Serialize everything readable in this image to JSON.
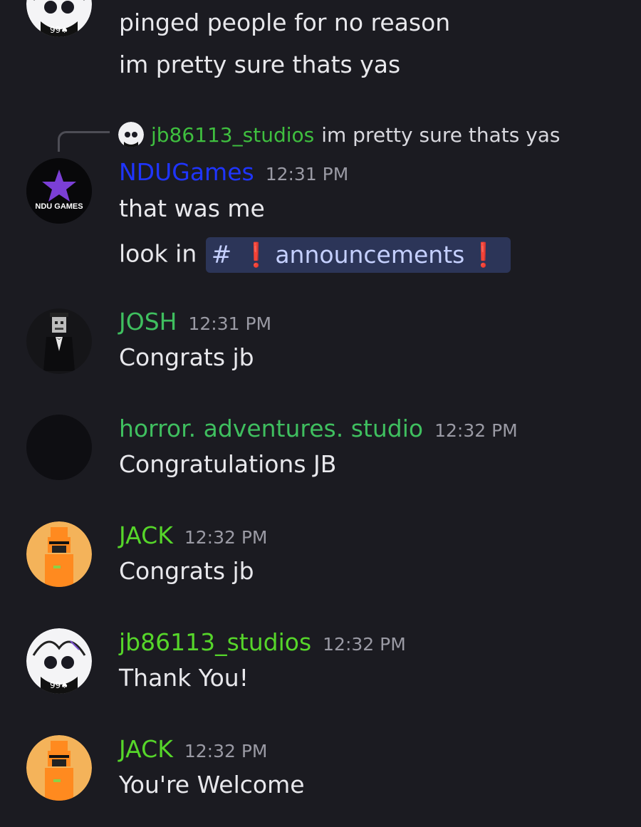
{
  "colors": {
    "background": "#1b1b21",
    "text": "#e8e8ec",
    "timestamp": "#9a9aa4",
    "mention_bg": "#2c3558",
    "mention_text": "#c5d0ff"
  },
  "top_continuation": {
    "lines": [
      "pinged people for no reason",
      "im pretty sure thats yas"
    ]
  },
  "reply_preview": {
    "author": "jb86113_studios",
    "text": "im pretty sure thats yas",
    "author_color": "#3fbf3f"
  },
  "messages": [
    {
      "author": "NDUGames",
      "author_color": "#1f35ff",
      "time": "12:31 PM",
      "avatar": "ndu-games-logo",
      "avatar_label": "NDU GAMES",
      "lines": [
        "that was me",
        "look in"
      ],
      "mention": {
        "hash": "#",
        "prefix_emoji": "❗",
        "channel": "announcements",
        "suffix_emoji": "❗"
      }
    },
    {
      "author": "JOSH",
      "author_color": "#3fbf5f",
      "time": "12:31 PM",
      "avatar": "tuxedo-figure-avatar",
      "lines": [
        "Congrats jb"
      ]
    },
    {
      "author": "horror. adventures. studio",
      "author_color": "#3fbf5f",
      "time": "12:32 PM",
      "avatar": "dark-avatar",
      "lines": [
        "Congratulations JB"
      ]
    },
    {
      "author": "JACK",
      "author_color": "#56d62a",
      "time": "12:32 PM",
      "avatar": "orange-robot-avatar",
      "lines": [
        "Congrats jb"
      ]
    },
    {
      "author": "jb86113_studios",
      "author_color": "#56d62a",
      "time": "12:32 PM",
      "avatar": "sketch-character-avatar",
      "lines": [
        "Thank You!"
      ]
    },
    {
      "author": "JACK",
      "author_color": "#56d62a",
      "time": "12:32 PM",
      "avatar": "orange-robot-avatar",
      "lines": [
        "You're Welcome"
      ]
    }
  ]
}
